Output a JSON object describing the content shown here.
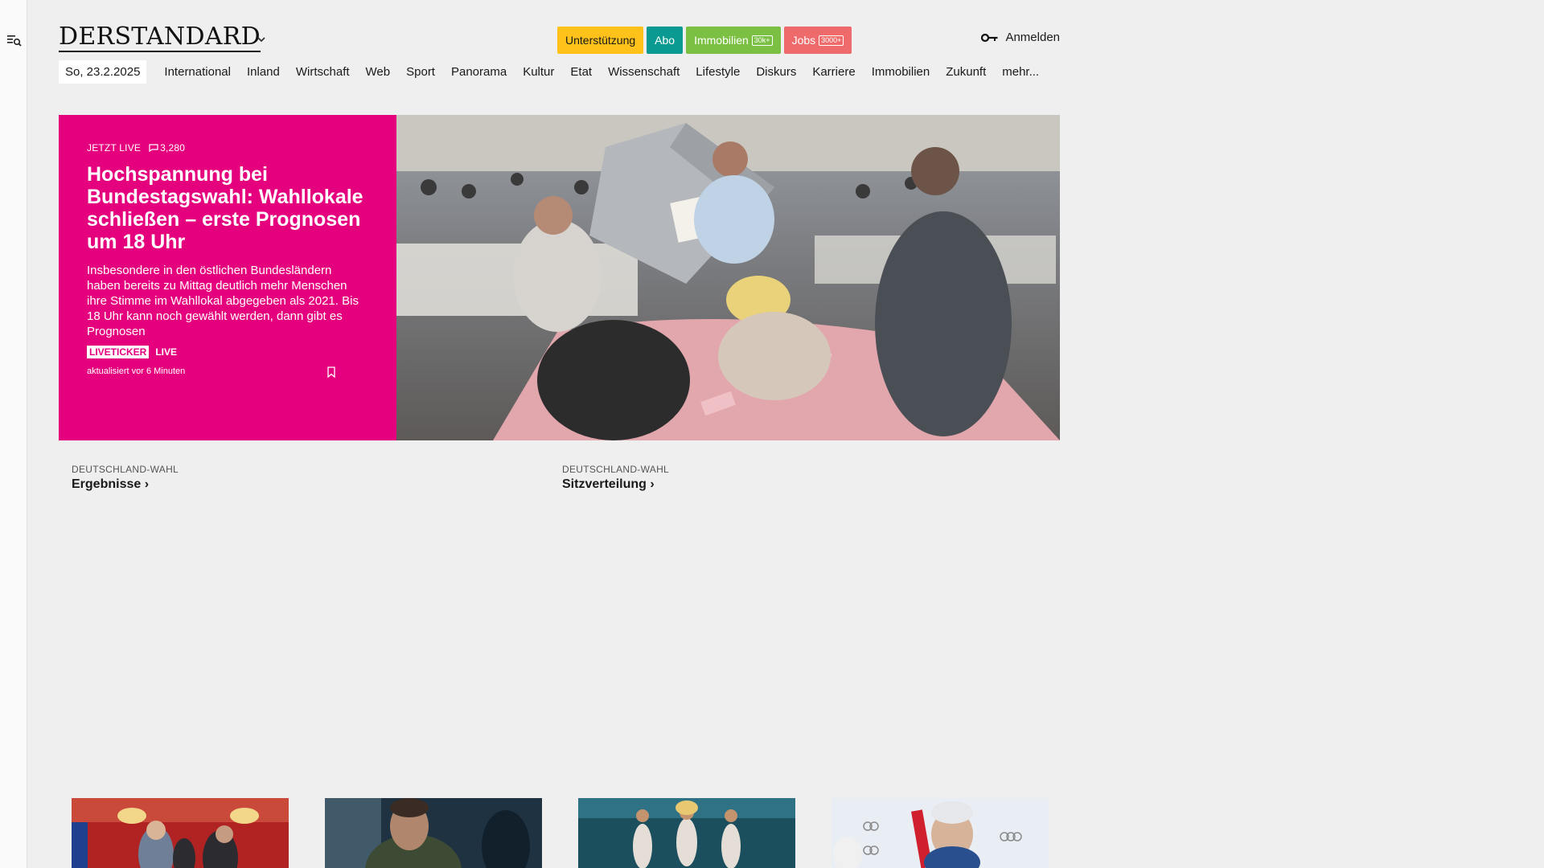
{
  "brand": {
    "logo": "DERSTANDARD",
    "accent": "#e5007e"
  },
  "top_pills": {
    "support": "Unterstützung",
    "abo": "Abo",
    "immobilien": "Immobilien",
    "immobilien_tag": "30k+",
    "jobs": "Jobs",
    "jobs_tag": "3000+"
  },
  "login": {
    "label": "Anmelden",
    "icon": "key-icon"
  },
  "nav": {
    "date": "So, 23.2.2025",
    "items": [
      "International",
      "Inland",
      "Wirtschaft",
      "Web",
      "Sport",
      "Panorama",
      "Kultur",
      "Etat",
      "Wissenschaft",
      "Lifestyle",
      "Diskurs",
      "Karriere",
      "Immobilien",
      "Zukunft",
      "mehr..."
    ]
  },
  "hero": {
    "kicker": "JETZT LIVE",
    "comments": "3,280",
    "title": "Hochspannung bei Bundestagswahl: Wahllokale schließen – erste Prognosen um 18 Uhr",
    "lead": "Insbesondere in den östlichen Bundesländern haben bereits zu Mittag deutlich mehr Menschen ihre Stimme im Wahllokal abgegeben als 2021. Bis 18 Uhr kann noch gewählt werden, dann gibt es Prognosen",
    "badge_ticker": "LIVETICKER",
    "badge_live": "LIVE",
    "updated": "aktualisiert vor 6 Minuten"
  },
  "sub_links": [
    {
      "kicker": "DEUTSCHLAND-WAHL",
      "title": "Ergebnisse ›"
    },
    {
      "kicker": "DEUTSCHLAND-WAHL",
      "title": "Sitzverteilung ›"
    }
  ]
}
